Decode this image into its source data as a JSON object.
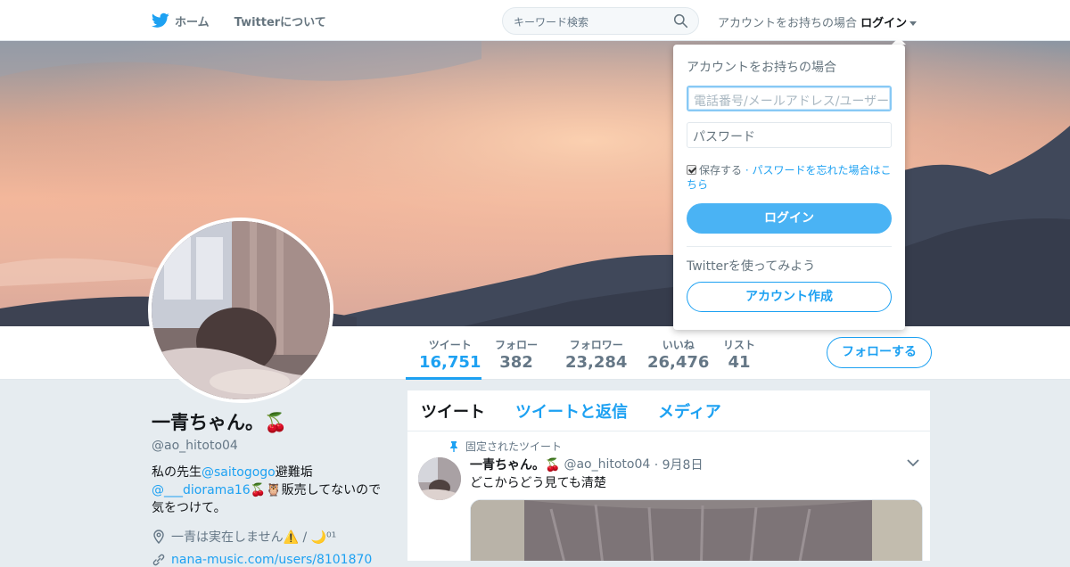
{
  "topbar": {
    "home_label": "ホーム",
    "about_label": "Twitterについて",
    "search_placeholder": "キーワード検索",
    "login_prefix": "アカウントをお持ちの場合",
    "login_label": "ログイン"
  },
  "colors": {
    "accent": "#1da1f2",
    "background": "#e6ecf0"
  },
  "profile_nav": {
    "stats": [
      {
        "label": "ツイート",
        "value": "16,751"
      },
      {
        "label": "フォロー",
        "value": "382"
      },
      {
        "label": "フォロワー",
        "value": "23,284"
      },
      {
        "label": "いいね",
        "value": "26,476"
      },
      {
        "label": "リスト",
        "value": "41"
      }
    ],
    "follow_button": "フォローする"
  },
  "profile": {
    "name": "一青ちゃん。🍒",
    "handle": "@ao_hitoto04",
    "bio_1": "私の先生",
    "bio_link_1": "@saitogogo",
    "bio_2": "避難垢",
    "bio_link_2": "@___diorama16",
    "bio_3": "🍒🦉販売してないので気をつけて。",
    "location": "一青は実在しません⚠️ / 🌙⁰¹",
    "url": "nana-music.com/users/8101870"
  },
  "timeline": {
    "tabs": [
      "ツイート",
      "ツイートと返信",
      "メディア"
    ],
    "pinned_label": "固定されたツイート",
    "tweet": {
      "name": "一青ちゃん。🍒",
      "handle": "@ao_hitoto04",
      "date": "· 9月8日",
      "text": "どこからどう見ても清楚"
    }
  },
  "login_dropdown": {
    "title": "アカウントをお持ちの場合",
    "username_placeholder": "電話番号/メールアドレス/ユーザー名",
    "password_placeholder": "パスワード",
    "remember_label": "保存する",
    "forgot_link": "· パスワードを忘れた場合はこちら",
    "login_button": "ログイン",
    "try_label": "Twitterを使ってみよう",
    "signup_button": "アカウント作成"
  }
}
